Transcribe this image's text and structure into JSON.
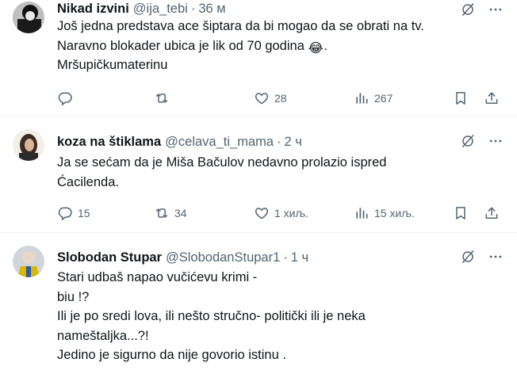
{
  "tweets": [
    {
      "name": "Nikad izvini",
      "handle": "@ija_tebi",
      "sep": "·",
      "time": "36 м",
      "lines": [
        "Još jedna predstava ace šiptara da bi mogao da se obrati na tv.",
        "Naravno blokader ubica je lik od 70 godina",
        "Mršupičkumaterinu"
      ],
      "emoji": "😂",
      "emoji_trail": ".",
      "replies": "",
      "retweets": "",
      "likes": "28",
      "views": "267"
    },
    {
      "name": "koza na štiklama",
      "handle": "@celava_ti_mama",
      "sep": "·",
      "time": "2 ч",
      "lines": [
        "Ja se sećam da je Miša Bačulov nedavno prolazio ispred",
        "Ćacilenda."
      ],
      "replies": "15",
      "retweets": "34",
      "likes": "1 хиљ.",
      "views": "15 хиљ."
    },
    {
      "name": "Slobodan Stupar",
      "handle": "@SlobodanStupar1",
      "sep": "·",
      "time": "1 ч",
      "lines": [
        "Stari udbaš napao vučićevu krimi -",
        "biu !?",
        "Ili je po sredi lova, ili nešto stručno- politički ili je neka",
        "nameštaljka...?!",
        "Jedino je sigurno da nije govorio istinu ."
      ]
    }
  ],
  "icons": {
    "reply": "reply-icon",
    "retweet": "retweet-icon",
    "like": "heart-icon",
    "views": "views-chart-icon",
    "bookmark": "bookmark-icon",
    "share": "share-icon",
    "grok": "grok-slash-icon",
    "more": "more-dots-icon"
  },
  "colors": {
    "text": "#0f1419",
    "muted": "#536471",
    "divider": "#eff3f4",
    "background": "#ffffff"
  }
}
